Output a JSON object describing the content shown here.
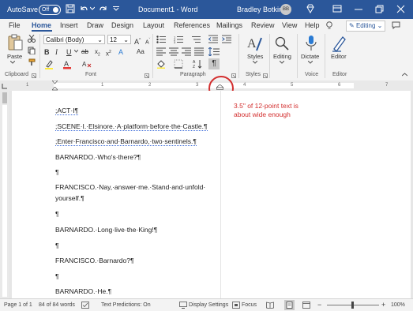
{
  "titlebar": {
    "autosave_label": "AutoSave",
    "autosave_state": "Off",
    "document_title": "Document1 - Word",
    "user_name": "Bradley Botkin",
    "user_initials": "BB"
  },
  "tabs": [
    "File",
    "Home",
    "Insert",
    "Draw",
    "Design",
    "Layout",
    "References",
    "Mailings",
    "Review",
    "View",
    "Help"
  ],
  "active_tab": "Home",
  "editing_mode_label": "Editing",
  "ribbon": {
    "font_name": "Calibri (Body)",
    "font_size": "12",
    "paste_label": "Paste",
    "styles_label": "Styles",
    "editing_label": "Editing",
    "dictate_label": "Dictate",
    "editor_label": "Editor",
    "groups": {
      "clipboard": "Clipboard",
      "font": "Font",
      "paragraph": "Paragraph",
      "styles": "Styles",
      "voice": "Voice",
      "editor": "Editor"
    }
  },
  "ruler": {
    "numbers": [
      "1",
      "1",
      "2",
      "3",
      "4",
      "5",
      "6",
      "7"
    ]
  },
  "document": {
    "paragraphs": [
      ";ACT·I¶",
      ";SCENE·I.·Elsinore.·A·platform·before·the·Castle.¶",
      ";Enter·Francisco·and·Barnardo,·two·sentinels.¶",
      "BARNARDO.·Who's·there?¶",
      "¶",
      "FRANCISCO.·Nay,·answer·me.·Stand·and·unfold·",
      "yourself.¶",
      "¶",
      "BARNARDO.·Long·live·the·King!¶",
      "¶",
      "FRANCISCO.·Barnardo?¶",
      "¶",
      "BARNARDO.·He.¶"
    ]
  },
  "annotation": {
    "line1": "3.5\" of 12-point text is",
    "line2": "about wide enough",
    "color": "#d32f2f"
  },
  "statusbar": {
    "page": "Page 1 of 1",
    "words": "84 of 84 words",
    "text_predictions": "Text Predictions: On",
    "display_settings": "Display Settings",
    "focus": "Focus",
    "zoom": "100%",
    "zoom_minus": "−",
    "zoom_plus": "+"
  },
  "colors": {
    "word_blue": "#2b579a",
    "ribbon_bg": "#f3f3f3",
    "annotation_red": "#d32f2f"
  }
}
